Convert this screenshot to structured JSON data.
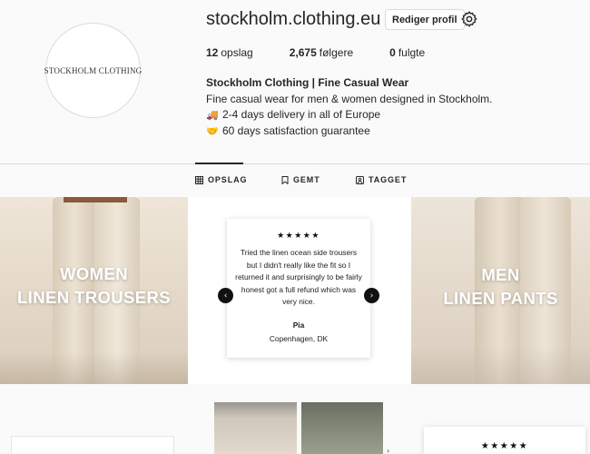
{
  "profile": {
    "avatar_text": "STOCKHOLM CLOTHING",
    "username": "stockholm.clothing.eu",
    "edit_button": "Rediger profil",
    "settings_icon": "gear-icon"
  },
  "stats": {
    "posts_count": "12",
    "posts_label": "opslag",
    "followers_count": "2,675",
    "followers_label": "følgere",
    "following_count": "0",
    "following_label": "fulgte"
  },
  "bio": {
    "name": "Stockholm Clothing | Fine Casual Wear",
    "line1": "Fine casual wear for men & women designed in Stockholm.",
    "line2_emoji": "🚚",
    "line2": "2-4 days delivery in all of Europe",
    "line3_emoji": "🤝",
    "line3": "60 days satisfaction guarantee"
  },
  "tabs": [
    {
      "label": "OPSLAG",
      "icon": "grid-icon",
      "active": true
    },
    {
      "label": "GEMT",
      "icon": "bookmark-icon",
      "active": false
    },
    {
      "label": "TAGGET",
      "icon": "tagged-icon",
      "active": false
    }
  ],
  "posts": {
    "women": {
      "line1": "WOMEN",
      "line2": "LINEN TROUSERS"
    },
    "men": {
      "line1": "MEN",
      "line2": "LINEN PANTS"
    },
    "review": {
      "stars": "★★★★★",
      "text": "Tried the linen ocean side trousers but I didn't really like the fit so I returned it and surprisingly to be fairly honest got a full refund which was very nice.",
      "reviewer": "Pia",
      "location": "Copenhagen, DK",
      "prev_icon": "chevron-left-icon",
      "next_icon": "chevron-right-icon"
    },
    "row2_review_stars": "★★★★★"
  },
  "colors": {
    "background": "#fafafa",
    "text": "#262626",
    "muted": "#8e8e8e",
    "border": "#dbdbdb"
  }
}
